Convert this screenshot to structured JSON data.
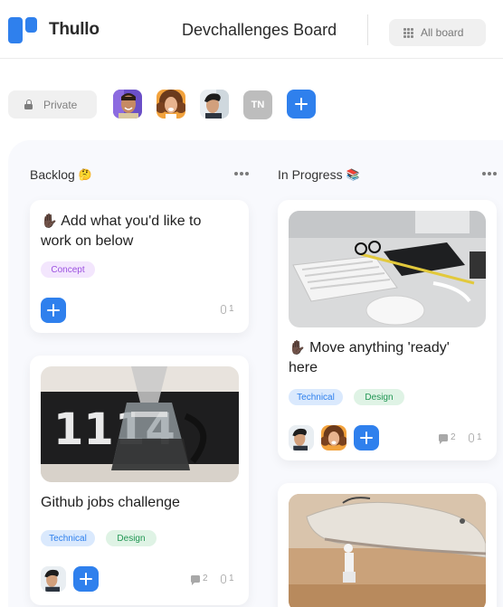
{
  "header": {
    "brand": "Thullo",
    "board_title": "Devchallenges Board",
    "all_board_label": "All board"
  },
  "toolbar": {
    "visibility_label": "Private",
    "members": [
      {
        "icon": "avatar-man-smiling"
      },
      {
        "icon": "avatar-woman-curly-hair"
      },
      {
        "icon": "avatar-man-dark-hair"
      }
    ],
    "initials_avatar": "TN"
  },
  "columns": [
    {
      "title": "Backlog",
      "emoji": "🤔",
      "cards": [
        {
          "title_emoji": "✋🏿",
          "title": "Add what you'd like to work on below",
          "tags": [
            "Concept"
          ],
          "attachments": "1"
        },
        {
          "image": "coffee-maker-photo",
          "title": "Github jobs challenge",
          "tags": [
            "Technical",
            "Design"
          ],
          "comments": "2",
          "attachments": "1"
        }
      ]
    },
    {
      "title": "In Progress",
      "emoji": "📚",
      "cards": [
        {
          "image": "desk-keyboard-photo",
          "title_emoji": "✋🏿",
          "title": "Move anything 'ready' here",
          "tags": [
            "Technical",
            "Design"
          ],
          "comments": "2",
          "attachments": "1"
        },
        {
          "image": "sneaker-toy-photo"
        }
      ]
    }
  ],
  "colors": {
    "primary": "#2f80ed",
    "concept_bg": "#f3e6fd",
    "concept_text": "#9b51e0",
    "technical_bg": "#dae9fd",
    "technical_text": "#2f80ed",
    "design_bg": "#dff3e5",
    "design_text": "#219653",
    "board_bg": "#f8f9fd"
  }
}
